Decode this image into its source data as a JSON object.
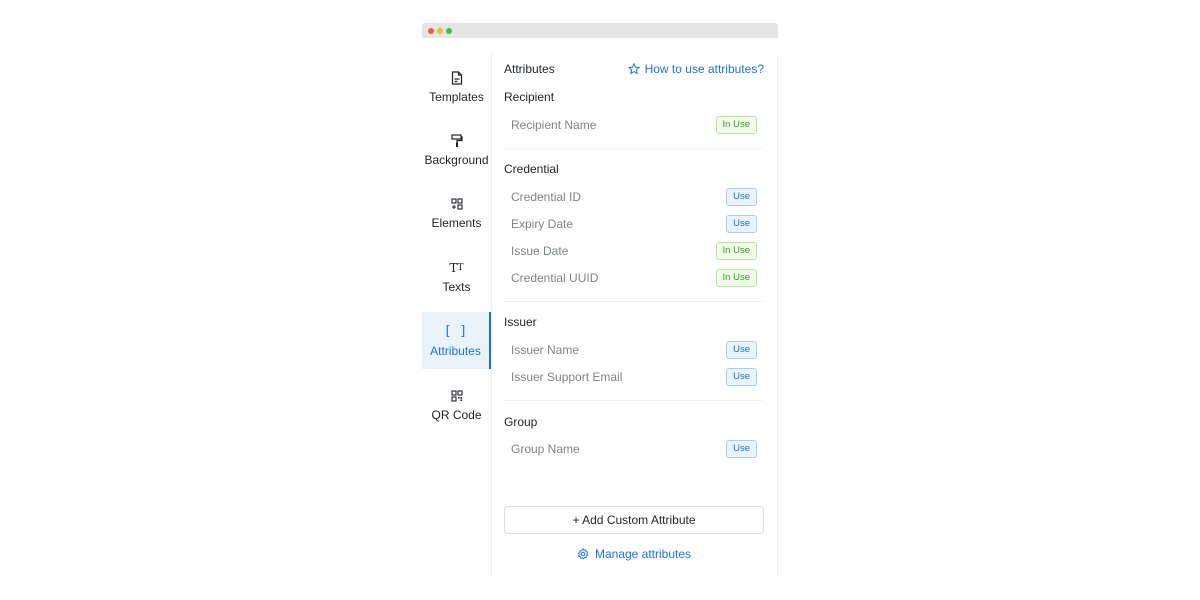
{
  "sidebar": {
    "items": [
      {
        "label": "Templates",
        "icon": "template-icon"
      },
      {
        "label": "Background",
        "icon": "paint-roller-icon"
      },
      {
        "label": "Elements",
        "icon": "elements-icon"
      },
      {
        "label": "Texts",
        "icon": "text-icon"
      },
      {
        "label": "Attributes",
        "icon": "brackets-icon"
      },
      {
        "label": "QR Code",
        "icon": "qr-code-icon"
      }
    ]
  },
  "panel": {
    "title": "Attributes",
    "help_link": "How to use attributes?",
    "sections": [
      {
        "title": "Recipient",
        "rows": [
          {
            "name": "Recipient Name",
            "badge": "In Use"
          }
        ]
      },
      {
        "title": "Credential",
        "rows": [
          {
            "name": "Credential ID",
            "badge": "Use"
          },
          {
            "name": "Expiry Date",
            "badge": "Use"
          },
          {
            "name": "Issue Date",
            "badge": "In Use"
          },
          {
            "name": "Credential UUID",
            "badge": "In Use"
          }
        ]
      },
      {
        "title": "Issuer",
        "rows": [
          {
            "name": "Issuer Name",
            "badge": "Use"
          },
          {
            "name": "Issuer Support Email",
            "badge": "Use"
          }
        ]
      },
      {
        "title": "Group",
        "rows": [
          {
            "name": "Group Name",
            "badge": "Use"
          }
        ]
      }
    ],
    "add_button": "+ Add Custom Attribute",
    "manage_link": "Manage attributes"
  },
  "colors": {
    "accent": "#1a73d9",
    "in_use_green": "#3c9a2d"
  }
}
